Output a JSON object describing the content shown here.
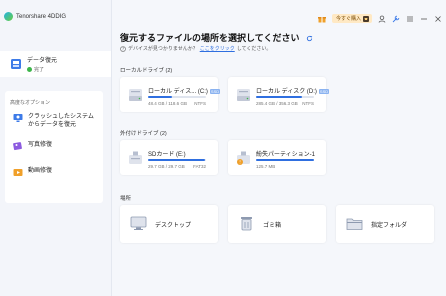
{
  "app": {
    "name": "Tenorshare 4DDIG"
  },
  "sidebar": {
    "data_recovery": {
      "title": "データ復元",
      "status": "完了",
      "status_color": "#3cb54a"
    },
    "advanced_title": "高度なオプション",
    "advanced_items": [
      {
        "label_line1": "クラッシュしたシステム",
        "label_line2": "からデータを復元",
        "icon": "computer-rescue-icon"
      },
      {
        "label_line1": "写真修復",
        "label_line2": "",
        "icon": "photo-repair-icon"
      },
      {
        "label_line1": "動画修復",
        "label_line2": "",
        "icon": "video-repair-icon"
      }
    ]
  },
  "topbar": {
    "buy_label": "今すぐ購入"
  },
  "main": {
    "title": "復元するファイルの場所を選択してください",
    "hint_text": "デバイスが見つかりませんか？",
    "hint_link": "ここをクリック",
    "hint_suffix": "してください。",
    "local_section": "ローカルドライブ (2)",
    "local_drives": [
      {
        "name": "ローカル ディス... (C:)",
        "badge": "SSD",
        "size": "48.4 GB / 118.6 GB",
        "fs": "NTFS",
        "used": 0.41
      },
      {
        "name": "ローカル ディスク (D:)",
        "badge": "SSD",
        "size": "285.4 GB / 356.3 GB",
        "fs": "NTFS",
        "used": 0.8
      }
    ],
    "external_section": "外付けドライブ (2)",
    "external_drives": [
      {
        "name": "SDカード (E:)",
        "size": "29.7 GB / 29.7 GB",
        "fs": "FAT32",
        "used": 0.99
      },
      {
        "name": "紛失パーティション-1",
        "size": "125.7 MB",
        "fs": "",
        "used": 1.0
      }
    ],
    "location_section": "場所",
    "locations": [
      {
        "label": "デスクトップ",
        "icon": "desktop-icon"
      },
      {
        "label": "ゴミ箱",
        "icon": "recycle-bin-icon"
      },
      {
        "label": "指定フォルダ",
        "icon": "folder-icon"
      }
    ]
  },
  "colors": {
    "accent": "#2f6fe0",
    "sidebar_bg": "#f3f5fa"
  }
}
